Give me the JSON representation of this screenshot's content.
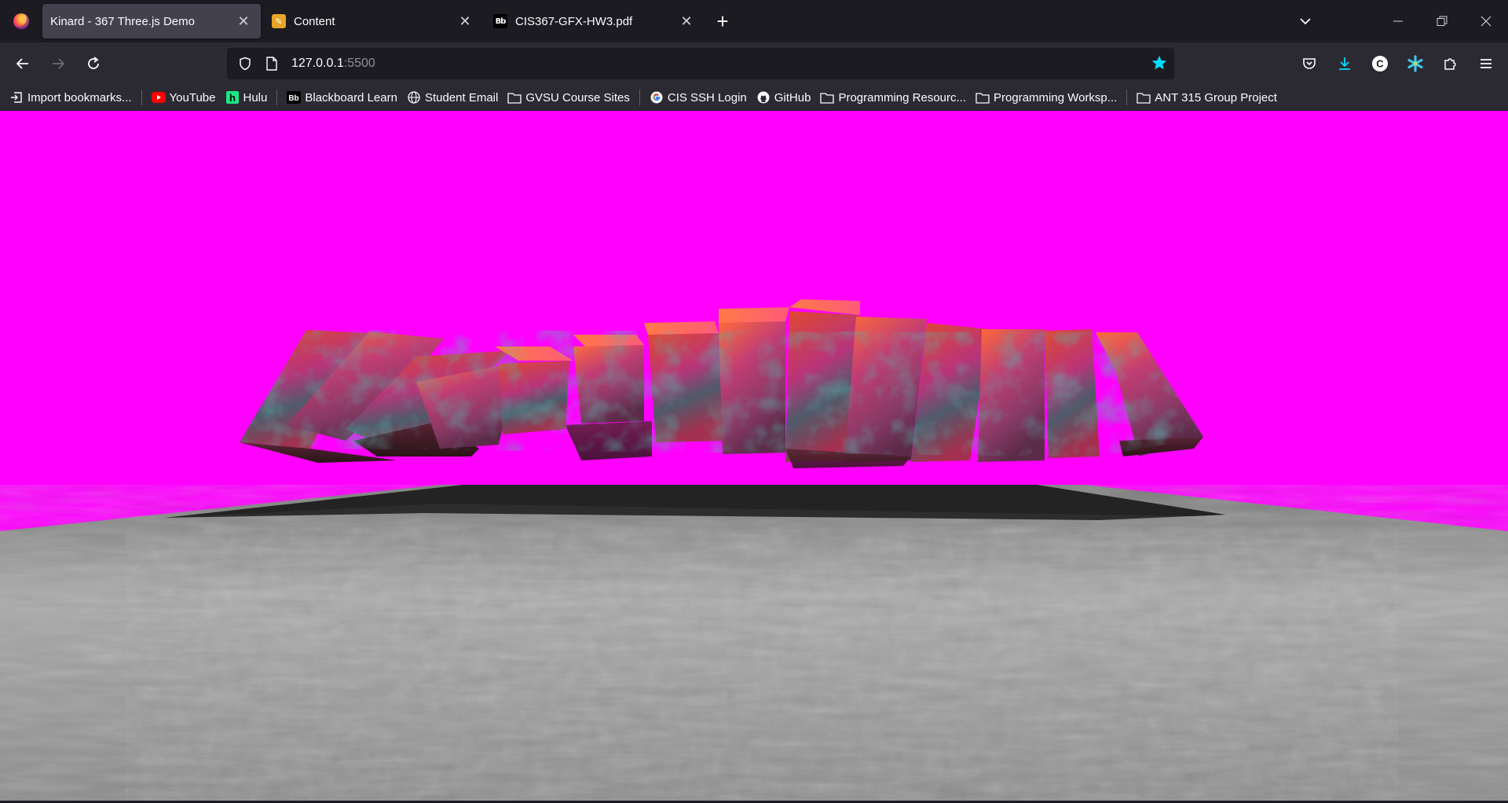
{
  "tabs": [
    {
      "title": "Kinard - 367 Three.js Demo",
      "active": true,
      "favicon": "firefox-icon"
    },
    {
      "title": "Content",
      "active": false,
      "favicon": "pencil-icon"
    },
    {
      "title": "CIS367-GFX-HW3.pdf",
      "active": false,
      "favicon": "blackboard-icon",
      "favicon_text": "Bb"
    }
  ],
  "url": {
    "host": "127.0.0.1",
    "port": ":5500"
  },
  "bookmarks": [
    {
      "label": "Import bookmarks...",
      "icon": "import-icon"
    },
    {
      "label": "YouTube",
      "icon": "youtube-icon"
    },
    {
      "label": "Hulu",
      "icon": "hulu-icon"
    },
    {
      "label": "Blackboard Learn",
      "icon": "blackboard-icon"
    },
    {
      "label": "Student Email",
      "icon": "globe-icon"
    },
    {
      "label": "GVSU Course Sites",
      "icon": "folder-icon"
    },
    {
      "label": "CIS SSH Login",
      "icon": "google-icon"
    },
    {
      "label": "GitHub",
      "icon": "github-icon"
    },
    {
      "label": "Programming Resourc...",
      "icon": "folder-icon"
    },
    {
      "label": "Programming Worksp...",
      "icon": "folder-icon"
    },
    {
      "label": "ANT 315 Group Project",
      "icon": "folder-icon"
    }
  ],
  "colors": {
    "scene_background": "#ff00ff",
    "tabstrip": "#1c1b22",
    "toolbar": "#2b2a33",
    "accent_star": "#00ddff"
  }
}
